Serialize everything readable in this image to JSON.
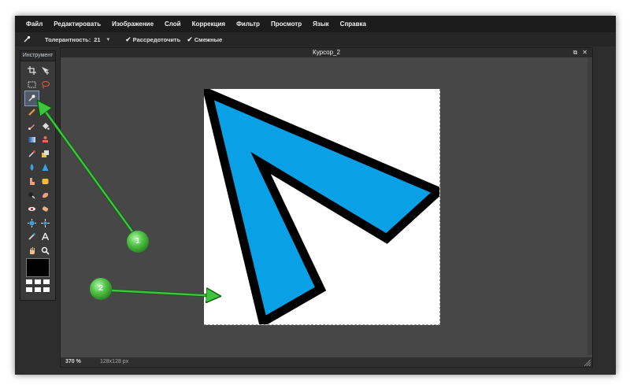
{
  "menu": [
    "Файл",
    "Редактировать",
    "Изображение",
    "Слой",
    "Коррекция",
    "Фильтр",
    "Просмотр",
    "Язык",
    "Справка"
  ],
  "options": {
    "tolerance_label": "Толерантность:",
    "tolerance_value": "21",
    "dropdown_icon": "chevron-down-icon",
    "checkbox1": "Рассредоточить",
    "checkbox2": "Смежные"
  },
  "toolpanel": {
    "title": "Инструмент",
    "tools": [
      "crop-icon",
      "move-icon",
      "marquee-icon",
      "lasso-icon",
      "magic-wand-icon",
      "",
      "pencil-icon",
      "",
      "brush-icon",
      "fill-bucket-icon",
      "gradient-icon",
      "stamp-icon",
      "color-replace-icon",
      "drawing-icon",
      "blur-icon",
      "sharpen-icon",
      "smudge-icon",
      "sponge-icon",
      "dodge-icon",
      "burn-icon",
      "red-eye-icon",
      "spot-heal-icon",
      "bloat-icon",
      "pinch-icon",
      "color-picker-icon",
      "text-icon",
      "hand-icon",
      "zoom-icon"
    ],
    "foreground_color": "#000000"
  },
  "document": {
    "title": "Курсор_2",
    "zoom": "370 %",
    "size": "128x128 px",
    "canvas_bg": "#ffffff"
  },
  "artwork": {
    "fill_color": "#0aa0e6",
    "stroke_color": "#000000"
  },
  "annotations": {
    "marker1": "1",
    "marker2": "2",
    "color": "#3ec43e"
  }
}
